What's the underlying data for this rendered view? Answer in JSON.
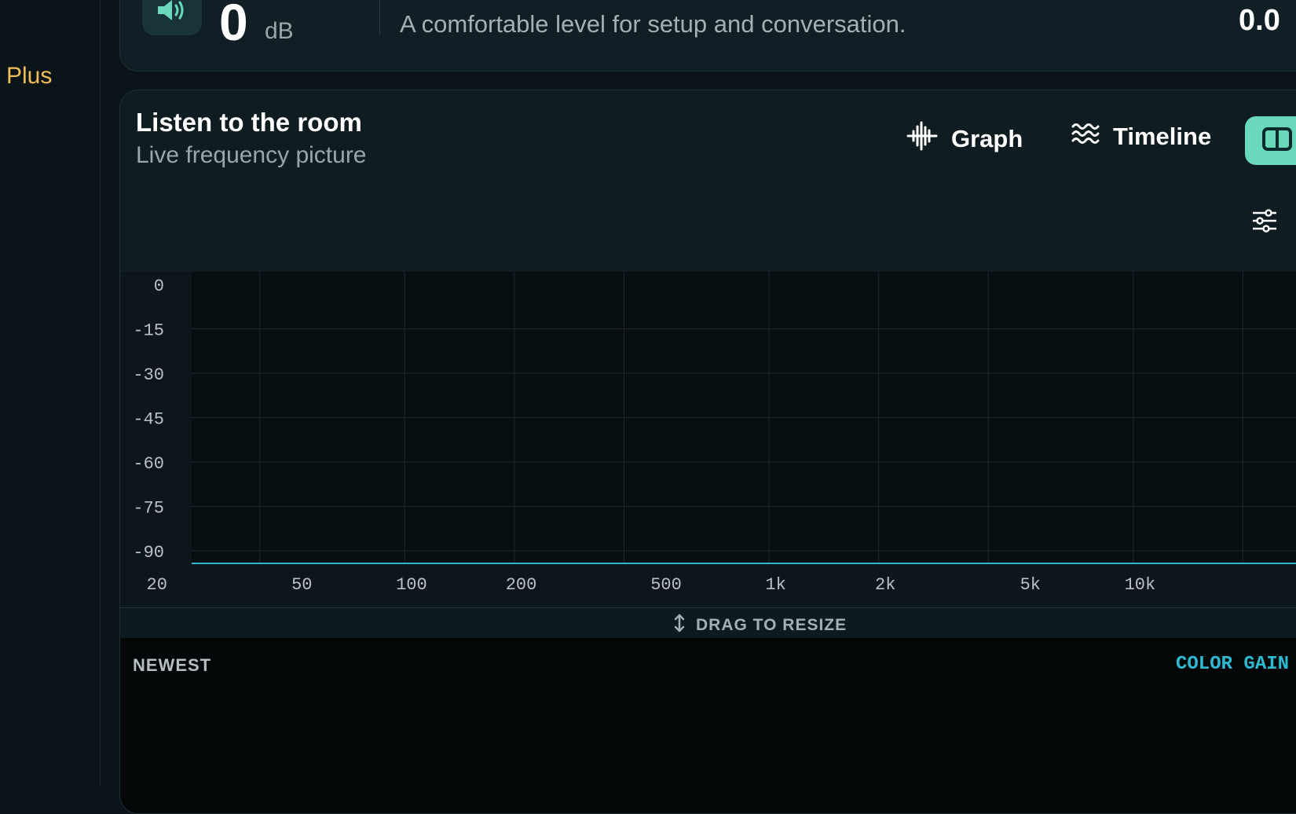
{
  "sidebar": {
    "plus_label": "Plus"
  },
  "level": {
    "icon": "speaker-icon",
    "value": "0",
    "unit": "dB",
    "description": "A comfortable level for setup and conversation.",
    "reading": "0.0"
  },
  "listen": {
    "title": "Listen to the room",
    "subtitle": "Live frequency picture",
    "tabs": [
      {
        "label": "Graph",
        "icon": "waveform-icon"
      },
      {
        "label": "Timeline",
        "icon": "waves-icon"
      },
      {
        "label": "",
        "icon": "split-view-icon",
        "active": true
      }
    ],
    "settings_icon": "sliders-icon"
  },
  "chart_data": {
    "type": "line",
    "x_scale": "log",
    "x_ticks": [
      "20",
      "50",
      "100",
      "200",
      "500",
      "1k",
      "2k",
      "5k",
      "10k"
    ],
    "y_ticks": [
      "0",
      "-15",
      "-30",
      "-45",
      "-60",
      "-75",
      "-90"
    ],
    "ylim": [
      -90,
      0
    ],
    "grid": true,
    "series": [
      {
        "x": [
          20,
          50,
          100,
          200,
          500,
          1000,
          2000,
          5000,
          10000,
          20000
        ],
        "values": [
          -90,
          -90,
          -90,
          -90,
          -90,
          -90,
          -90,
          -90,
          -90,
          -90
        ],
        "color": "#2fb5cf"
      }
    ]
  },
  "resize": {
    "label": "DRAG TO RESIZE",
    "icon": "resize-vertical-icon"
  },
  "timeline": {
    "newest_label": "NEWEST",
    "color_gain_label": "COLOR GAIN"
  },
  "colors": {
    "accent": "#6ad9bb",
    "highlight": "#f0bd5a",
    "trace": "#2fb5cf",
    "background": "#0b1519"
  }
}
